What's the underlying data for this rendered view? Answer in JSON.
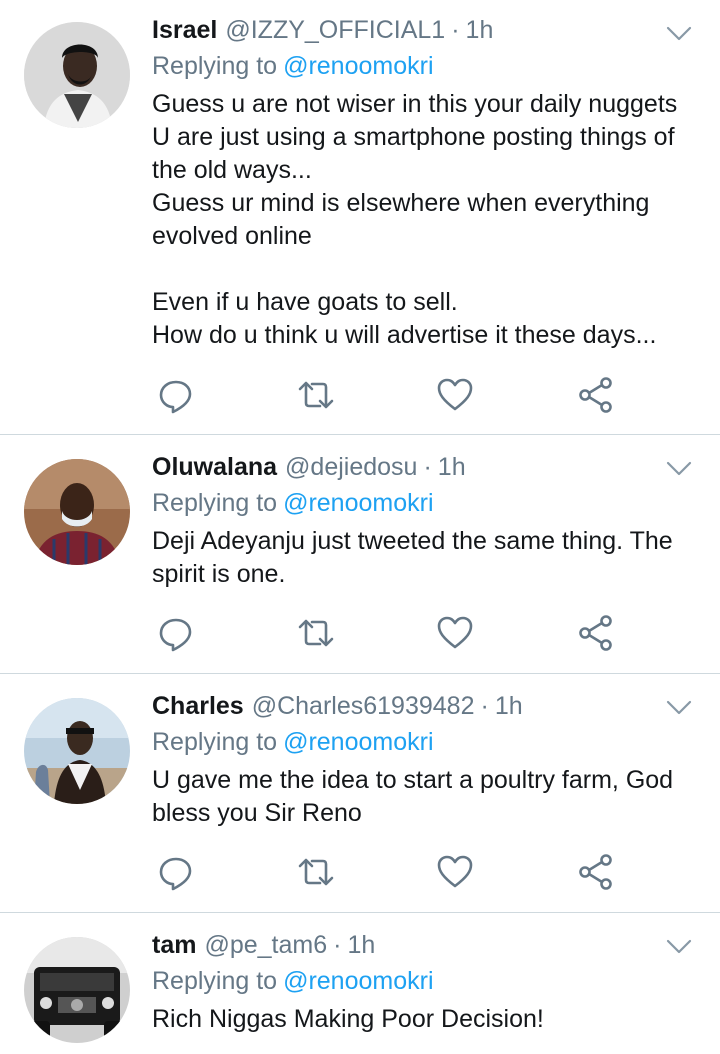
{
  "tweets": [
    {
      "name": "Israel",
      "handle": "@IZZY_OFFICIAL1",
      "time": "1h",
      "replying_label": "Replying to",
      "replying_to": "@renoomokri",
      "lines": [
        "Guess u are not wiser in this your daily nuggets",
        "U are just using a smartphone posting things of",
        "the old ways...",
        "Guess ur mind is elsewhere when everything",
        "evolved online",
        "",
        "Even if u have goats to sell.",
        "How do u think u will advertise it these days..."
      ]
    },
    {
      "name": "Oluwalana",
      "handle": "@dejiedosu",
      "time": "1h",
      "replying_label": "Replying to",
      "replying_to": "@renoomokri",
      "lines": [
        "Deji Adeyanju just tweeted the same thing. The",
        "spirit is one."
      ]
    },
    {
      "name": "Charles",
      "handle": "@Charles61939482",
      "time": "1h",
      "replying_label": "Replying to",
      "replying_to": "@renoomokri",
      "lines": [
        "U gave me the idea to start a poultry farm, God",
        "bless you Sir Reno"
      ]
    },
    {
      "name": "tam",
      "handle": "@pe_tam6",
      "time": "1h",
      "replying_label": "Replying to",
      "replying_to": "@renoomokri",
      "lines": [
        "Rich Niggas Making Poor Decision!"
      ]
    }
  ],
  "separator": "·",
  "colors": {
    "text": "#14171a",
    "secondary": "#657786",
    "link": "#1da1f2",
    "divider": "#cfd9de"
  },
  "icons": [
    "reply-icon",
    "retweet-icon",
    "like-icon",
    "share-icon",
    "chevron-down-icon"
  ]
}
